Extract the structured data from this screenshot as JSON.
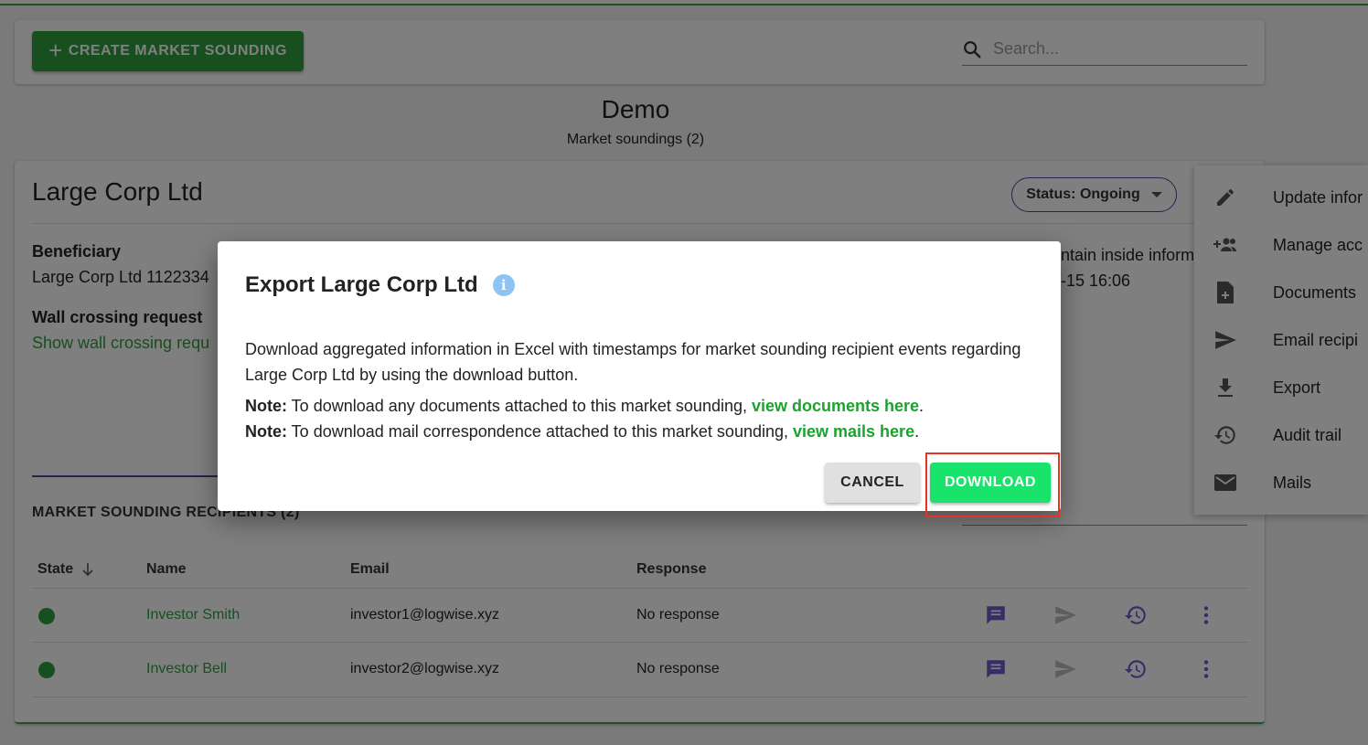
{
  "toolbar": {
    "create_label": "CREATE MARKET SOUNDING",
    "search_placeholder": "Search..."
  },
  "header": {
    "title": "Demo",
    "subtitle": "Market soundings (2)"
  },
  "card": {
    "title": "Large Corp Ltd",
    "status_label": "Status: Ongoing",
    "beneficiary_label": "Beneficiary",
    "beneficiary_value": "Large Corp Ltd 1122334",
    "wall_label": "Wall crossing request",
    "wall_link": "Show wall crossing requ",
    "inside_info_partial": "ntain inside inform",
    "timestamp_partial": "-15 16:06",
    "section_heading": "MARKET SOUNDING RECIPIENTS (2)"
  },
  "table": {
    "headers": [
      "State",
      "Name",
      "Email",
      "Response"
    ],
    "rows": [
      {
        "name": "Investor Smith",
        "email": "investor1@logwise.xyz",
        "response": "No response"
      },
      {
        "name": "Investor Bell",
        "email": "investor2@logwise.xyz",
        "response": "No response"
      }
    ]
  },
  "menu": {
    "items": [
      {
        "label": "Update infor",
        "icon": "pencil-icon"
      },
      {
        "label": "Manage acc",
        "icon": "add-group-icon"
      },
      {
        "label": "Documents",
        "icon": "document-add-icon"
      },
      {
        "label": "Email recipi",
        "icon": "send-icon"
      },
      {
        "label": "Export",
        "icon": "download-icon"
      },
      {
        "label": "Audit trail",
        "icon": "history-icon"
      },
      {
        "label": "Mails",
        "icon": "mail-icon"
      }
    ]
  },
  "dialog": {
    "title": "Export Large Corp Ltd",
    "body": "Download aggregated information in Excel with timestamps for market sounding recipient events regarding Large Corp Ltd by using the download button.",
    "note_prefix": "Note:",
    "note1_text": " To download any documents attached to this market sounding, ",
    "note1_link": "view documents here",
    "note2_text": " To download mail correspondence attached to this market sounding, ",
    "note2_link": "view mails here",
    "period": ".",
    "cancel_label": "CANCEL",
    "download_label": "DOWNLOAD"
  },
  "colors": {
    "brand_green": "#2e9e3c",
    "download_green": "#19e36b",
    "accent_purple": "#4a44a8",
    "highlight_red": "#e53222"
  }
}
